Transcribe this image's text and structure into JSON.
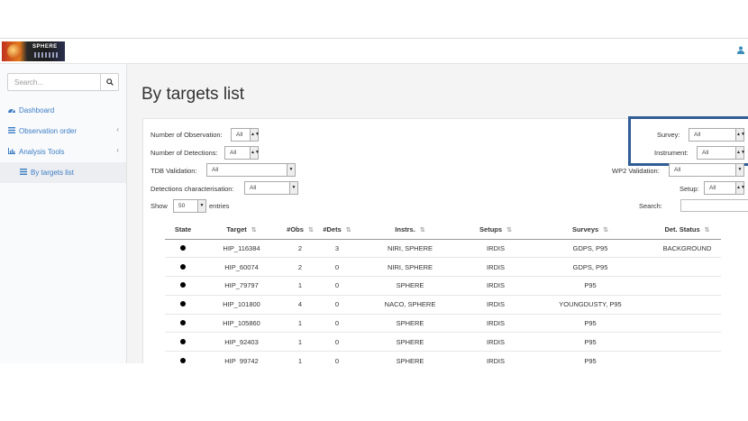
{
  "header": {
    "logo_text": "SPHERE",
    "user_icon": "user-icon"
  },
  "sidebar": {
    "search_placeholder": "Search...",
    "items": [
      {
        "label": "Dashboard",
        "icon": "dashboard-icon"
      },
      {
        "label": "Observation order",
        "icon": "list-icon"
      },
      {
        "label": "Analysis Tools",
        "icon": "bar-chart-icon"
      },
      {
        "label": "By targets list",
        "icon": "list-icon"
      }
    ]
  },
  "main": {
    "title": "By targets list",
    "filters": {
      "num_obs_label": "Number of Observation:",
      "num_obs_value": "All",
      "num_dets_label": "Number of Detections:",
      "num_dets_value": "All",
      "tdb_label": "TDB Validation:",
      "tdb_value": "All",
      "det_char_label": "Detections characterisation:",
      "det_char_value": "All",
      "survey_label": "Survey:",
      "survey_value": "All",
      "instrument_label": "Instrument:",
      "instrument_value": "All",
      "wp2_label": "WP2 Validation:",
      "wp2_value": "All",
      "setup_label": "Setup:",
      "setup_value": "All"
    },
    "show_label": "Show",
    "show_value": "50",
    "entries_label": "entries",
    "search_label": "Search:",
    "highlight_color": "#2f5d96",
    "table": {
      "columns": [
        "State",
        "Target",
        "#Obs",
        "#Dets",
        "Instrs.",
        "Setups",
        "Surveys",
        "Det. Status"
      ],
      "sortable": [
        false,
        true,
        true,
        true,
        true,
        true,
        true,
        true
      ],
      "rows": [
        {
          "target": "HIP_116384",
          "obs": "2",
          "dets": "3",
          "instrs": "NIRI, SPHERE",
          "setups": "IRDIS",
          "surveys": "GDPS, P95",
          "status": "BACKGROUND"
        },
        {
          "target": "HIP_60074",
          "obs": "2",
          "dets": "0",
          "instrs": "NIRI, SPHERE",
          "setups": "IRDIS",
          "surveys": "GDPS, P95",
          "status": ""
        },
        {
          "target": "HIP_79797",
          "obs": "1",
          "dets": "0",
          "instrs": "SPHERE",
          "setups": "IRDIS",
          "surveys": "P95",
          "status": ""
        },
        {
          "target": "HIP_101800",
          "obs": "4",
          "dets": "0",
          "instrs": "NACO, SPHERE",
          "setups": "IRDIS",
          "surveys": "YOUNGDUSTY, P95",
          "status": ""
        },
        {
          "target": "HIP_105860",
          "obs": "1",
          "dets": "0",
          "instrs": "SPHERE",
          "setups": "IRDIS",
          "surveys": "P95",
          "status": ""
        },
        {
          "target": "HIP_92403",
          "obs": "1",
          "dets": "0",
          "instrs": "SPHERE",
          "setups": "IRDIS",
          "surveys": "P95",
          "status": ""
        },
        {
          "target": "HIP_99742",
          "obs": "1",
          "dets": "0",
          "instrs": "SPHERE",
          "setups": "IRDIS",
          "surveys": "P95",
          "status": ""
        }
      ]
    }
  }
}
